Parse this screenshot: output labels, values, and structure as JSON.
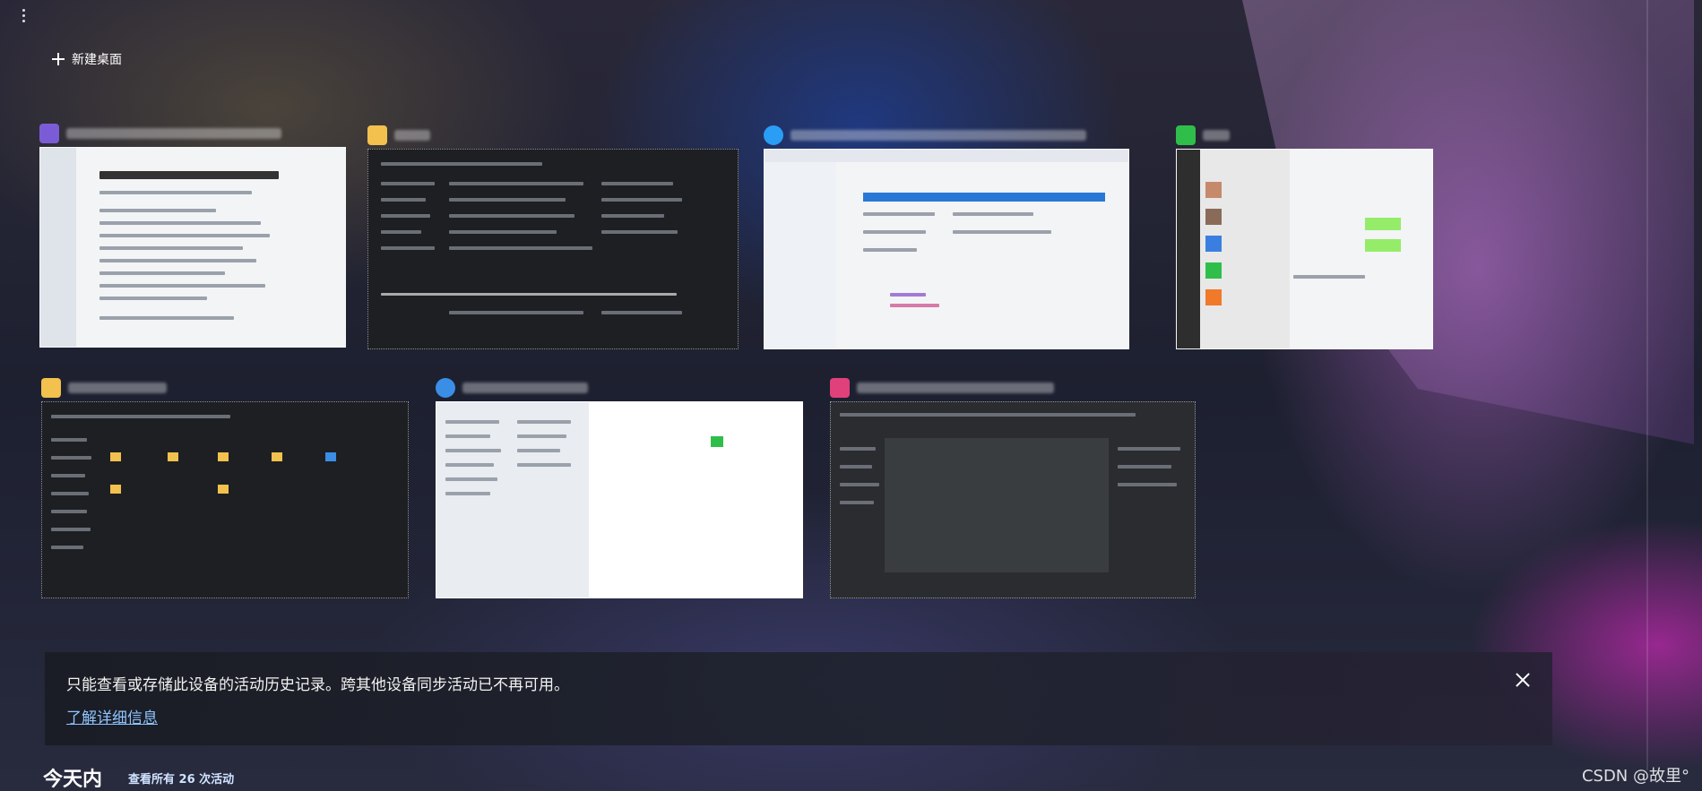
{
  "new_desktop": {
    "label": "新建桌面",
    "icon": "plus-icon"
  },
  "more_menu": {
    "icon": "more-vertical-icon"
  },
  "windows": [
    {
      "app": "document-app",
      "icon_color": "#7c5cd6"
    },
    {
      "app": "file-explorer",
      "icon_color": "#f2c14e"
    },
    {
      "app": "edge-browser",
      "icon_color": "#2a9df4"
    },
    {
      "app": "wechat",
      "icon_color": "#2fbe4a"
    },
    {
      "app": "file-explorer",
      "icon_color": "#f2c14e"
    },
    {
      "app": "app",
      "icon_color": "#3a8ee6"
    },
    {
      "app": "jetbrains-ide",
      "icon_color": "#e0417a"
    }
  ],
  "banner": {
    "message": "只能查看或存储此设备的活动历史记录。跨其他设备同步活动已不再可用。",
    "link_label": "了解详细信息",
    "close_icon": "close-icon"
  },
  "timeline": {
    "section_title": "今天内",
    "view_all_label": "查看所有 26 次活动"
  },
  "watermark": "CSDN @故里°",
  "colors": {
    "link": "#8ec5ff",
    "banner_bg": "#1e2230"
  }
}
